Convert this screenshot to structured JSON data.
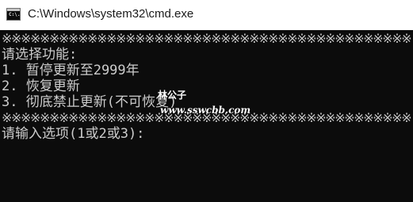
{
  "window": {
    "title": "C:\\Windows\\system32\\cmd.exe",
    "icon": "cmd-console-icon",
    "icon_text": "C:\\."
  },
  "console": {
    "separator_top": "※※※※※※※※※※※※※※※※※※※※※※※※※※※※※※※※※※※※※※※※※※※",
    "prompt_title": "请选择功能:",
    "options": [
      "1. 暂停更新至2999年",
      "2. 恢复更新",
      "3. 彻底禁止更新(不可恢复)"
    ],
    "separator_bottom": "※※※※※※※※※※※※※※※※※※※※※※※※※※※※※※※※※※※※※※※※※※※",
    "input_prompt": "请输入选项(1或2或3):"
  },
  "watermark": {
    "name": "林公子",
    "url": "www.sswcbb.com"
  },
  "colors": {
    "console_background": "#0c0c0c",
    "console_text": "#cccccc",
    "titlebar_background": "#ffffff"
  }
}
